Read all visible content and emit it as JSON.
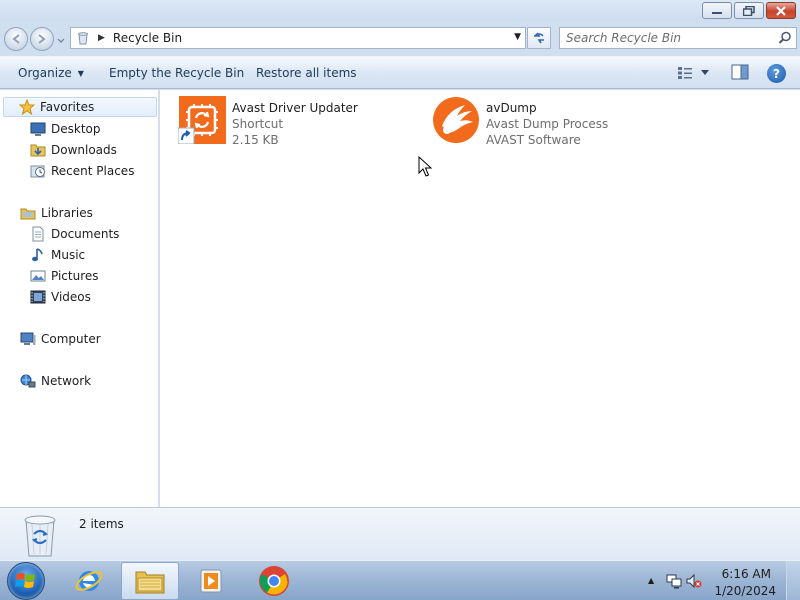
{
  "window": {
    "address": {
      "crumbs": [
        "Recycle Bin"
      ]
    },
    "search": {
      "placeholder": "Search Recycle Bin"
    },
    "commands": {
      "organize": "Organize",
      "empty": "Empty the Recycle Bin",
      "restore": "Restore all items"
    },
    "nav_pane": {
      "favorites": {
        "label": "Favorites",
        "items": [
          "Desktop",
          "Downloads",
          "Recent Places"
        ]
      },
      "libraries": {
        "label": "Libraries",
        "items": [
          "Documents",
          "Music",
          "Pictures",
          "Videos"
        ]
      },
      "computer": "Computer",
      "network": "Network"
    },
    "files": [
      {
        "name": "Avast Driver Updater",
        "line2": "Shortcut",
        "line3": "2.15 KB",
        "icon": "avast-driver-updater-icon"
      },
      {
        "name": "avDump",
        "line2": "Avast Dump Process",
        "line3": "AVAST Software",
        "icon": "avast-icon"
      }
    ],
    "details": {
      "count": "2 items"
    }
  },
  "taskbar": {
    "pinned": [
      "internet-explorer-icon",
      "file-explorer-icon",
      "media-player-icon",
      "chrome-icon"
    ],
    "active": "file-explorer-icon",
    "clock": {
      "time": "6:16 AM",
      "date": "1/20/2024"
    }
  },
  "colors": {
    "avast_orange": "#f26b1d",
    "selection": "#e2edfb",
    "window_frame": "#cfdfef"
  }
}
